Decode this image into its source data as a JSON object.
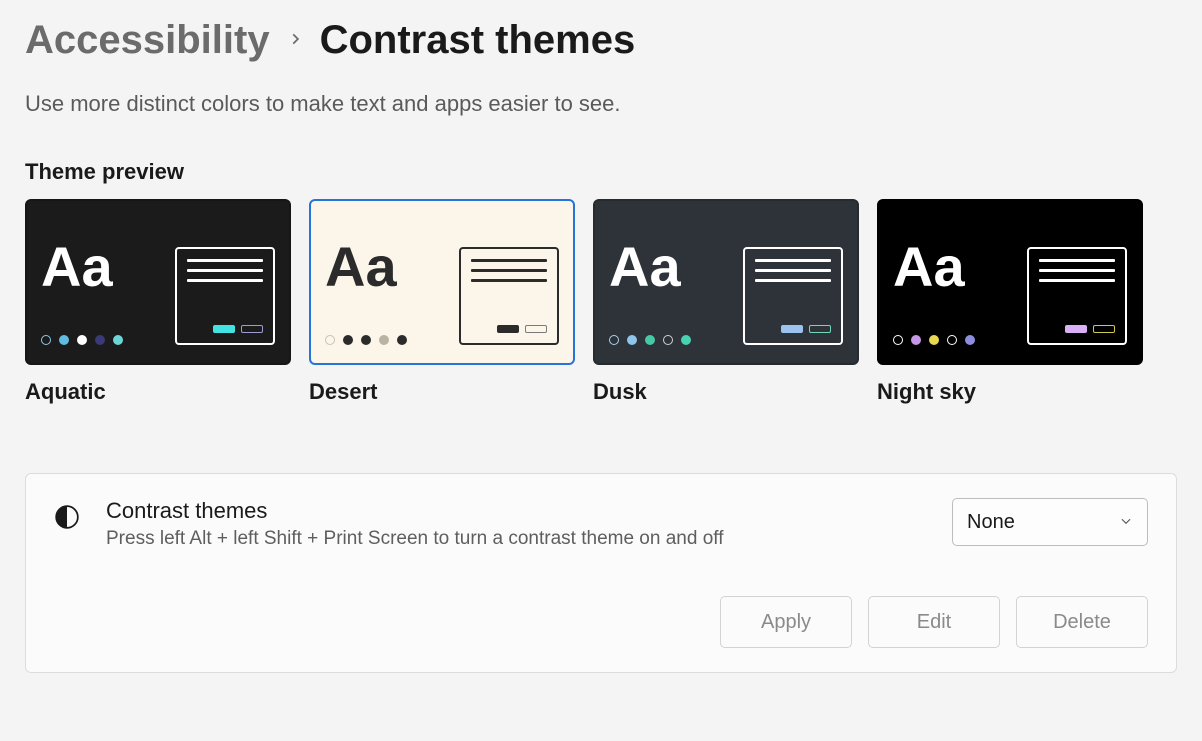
{
  "breadcrumb": {
    "parent": "Accessibility",
    "current": "Contrast themes"
  },
  "subtitle": "Use more distinct colors to make text and apps easier to see.",
  "section_heading": "Theme preview",
  "themes": [
    {
      "name": "Aquatic",
      "bg": "#1b1b1b",
      "fg": "#ffffff",
      "window_border": "#ffffff",
      "line_color": "#ffffff",
      "btn1": "#43e3e3",
      "btn2_border": "#9d9dd4",
      "dots": [
        {
          "color": "#8ec7e6",
          "ring": true
        },
        {
          "color": "#5fbce0"
        },
        {
          "color": "#ffffff"
        },
        {
          "color": "#3a3a78"
        },
        {
          "color": "#6cd6d6"
        }
      ],
      "selected": false
    },
    {
      "name": "Desert",
      "bg": "#fbf6e9",
      "fg": "#2b2b2b",
      "window_border": "#2b2b2b",
      "line_color": "#2b2b2b",
      "btn1": "#2b2b2b",
      "btn2_border": "#7a7a7a",
      "dots": [
        {
          "color": "#c7c2b2",
          "ring": true
        },
        {
          "color": "#2b2b2b"
        },
        {
          "color": "#2b2b2b"
        },
        {
          "color": "#b8b3a3"
        },
        {
          "color": "#2b2b2b"
        }
      ],
      "selected": true
    },
    {
      "name": "Dusk",
      "bg": "#2d3338",
      "fg": "#ffffff",
      "window_border": "#ffffff",
      "line_color": "#ffffff",
      "btn1": "#9cc2ef",
      "btn2_border": "#6fd9b8",
      "dots": [
        {
          "color": "#aad1f0",
          "ring": true
        },
        {
          "color": "#8fc5ea"
        },
        {
          "color": "#47c9a6"
        },
        {
          "color": "#d0d0d0",
          "ring": true
        },
        {
          "color": "#47d2b1"
        }
      ],
      "selected": false
    },
    {
      "name": "Night sky",
      "bg": "#000000",
      "fg": "#ffffff",
      "window_border": "#ffffff",
      "line_color": "#ffffff",
      "btn1": "#d9b0f5",
      "btn2_border": "#d4c84a",
      "dots": [
        {
          "color": "#ffffff",
          "ring": true
        },
        {
          "color": "#c598e6"
        },
        {
          "color": "#e7d84f"
        },
        {
          "color": "#ffffff",
          "ring": true
        },
        {
          "color": "#8d8de0"
        }
      ],
      "selected": false
    }
  ],
  "card": {
    "title": "Contrast themes",
    "desc": "Press left Alt + left Shift + Print Screen to turn a contrast theme on and off",
    "select_value": "None",
    "buttons": {
      "apply": "Apply",
      "edit": "Edit",
      "delete": "Delete"
    }
  }
}
